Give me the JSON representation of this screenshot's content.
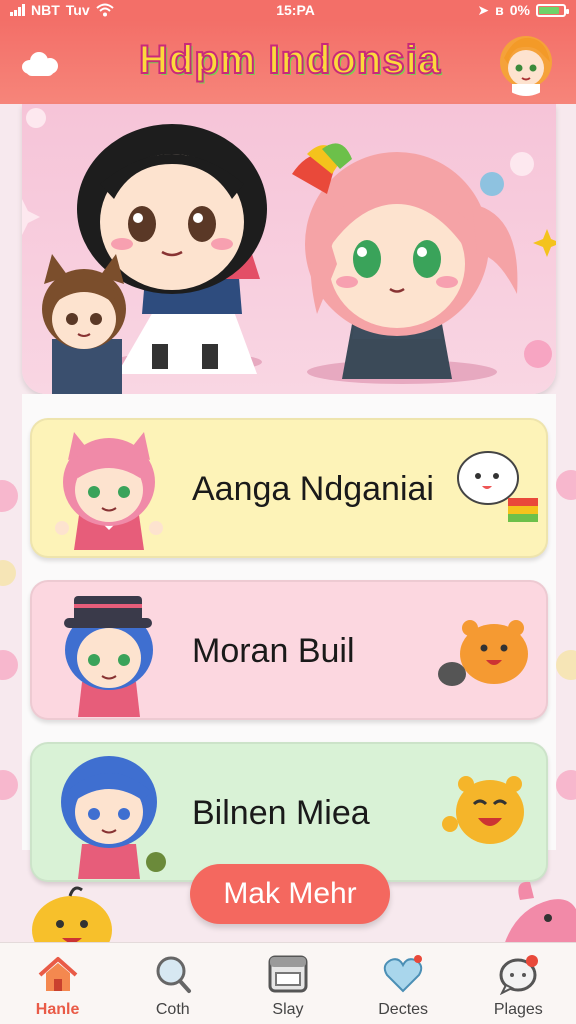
{
  "status_bar": {
    "carrier": "NBT",
    "network": "Tuv",
    "time": "15:PA",
    "battery": "0%",
    "battery_level": 0.85
  },
  "header": {
    "title": "Hdpm Indonsia"
  },
  "cards": [
    {
      "name": "Aanga Ndganiai",
      "bg": "#fdf3b8"
    },
    {
      "name": "Moran Buil",
      "bg": "#fcd7e0"
    },
    {
      "name": "Bilnen Miea",
      "bg": "#d9f2d6"
    }
  ],
  "cta": {
    "label": "Mak Mehr"
  },
  "nav": [
    {
      "label": "Hanle",
      "icon": "home-icon",
      "active": true
    },
    {
      "label": "Coth",
      "icon": "search-icon",
      "active": false
    },
    {
      "label": "Slay",
      "icon": "window-icon",
      "active": false
    },
    {
      "label": "Dectes",
      "icon": "heart-icon",
      "active": false
    },
    {
      "label": "Plages",
      "icon": "chat-bubble-icon",
      "active": false
    }
  ],
  "colors": {
    "accent": "#f36f68",
    "button": "#f4685f",
    "active_nav": "#e95b47"
  }
}
